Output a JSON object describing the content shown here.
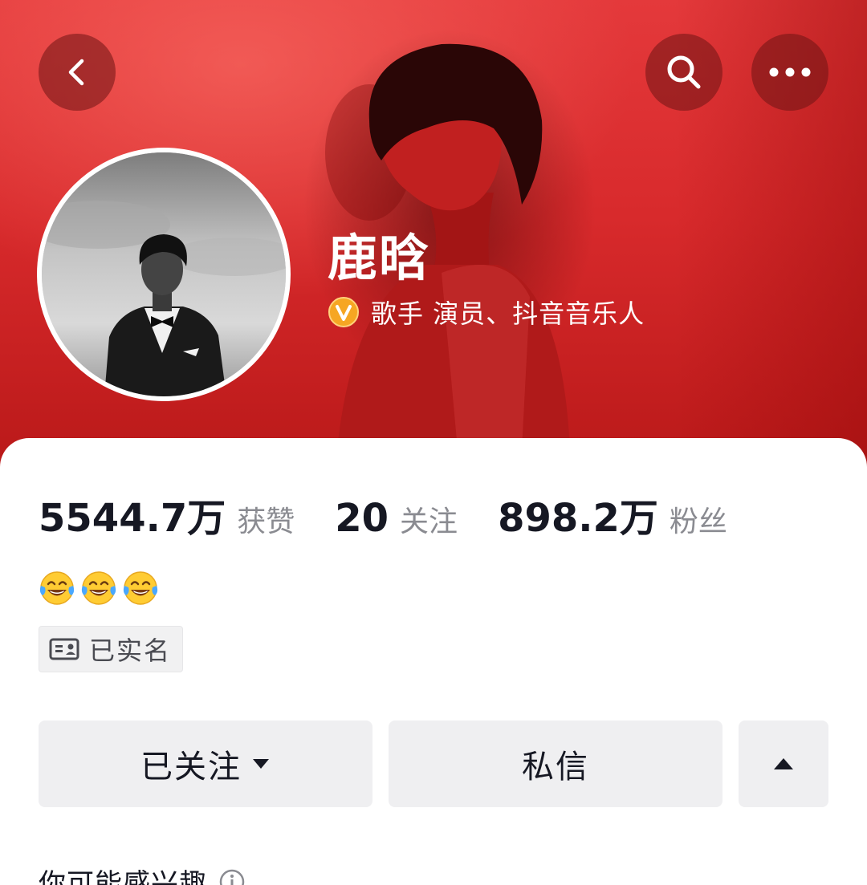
{
  "header": {
    "back_icon": "chevron-left-icon",
    "search_icon": "search-icon",
    "more_icon": "more-dots-icon"
  },
  "profile": {
    "name": "鹿晗",
    "verification_icon": "verified-badge-icon",
    "verification_text": "歌手 演员、抖音音乐人",
    "accent_color": "#f6a623"
  },
  "stats": [
    {
      "value": "5544.7万",
      "label": "获赞"
    },
    {
      "value": "20",
      "label": "关注"
    },
    {
      "value": "898.2万",
      "label": "粉丝"
    }
  ],
  "bio": {
    "emojis": [
      "tears-of-joy-emoji",
      "tears-of-joy-emoji",
      "tears-of-joy-emoji"
    ]
  },
  "tags": {
    "real_name": "已实名",
    "real_name_icon": "id-card-icon"
  },
  "actions": {
    "follow_label": "已关注",
    "message_label": "私信",
    "expand_icon": "caret-up-icon"
  },
  "suggestions": {
    "title": "你可能感兴趣",
    "info_icon": "info-icon"
  },
  "colors": {
    "banner": "#d82a2c",
    "text_primary": "#161823",
    "text_secondary": "#8a8b91",
    "button_bg": "#efeff1"
  }
}
